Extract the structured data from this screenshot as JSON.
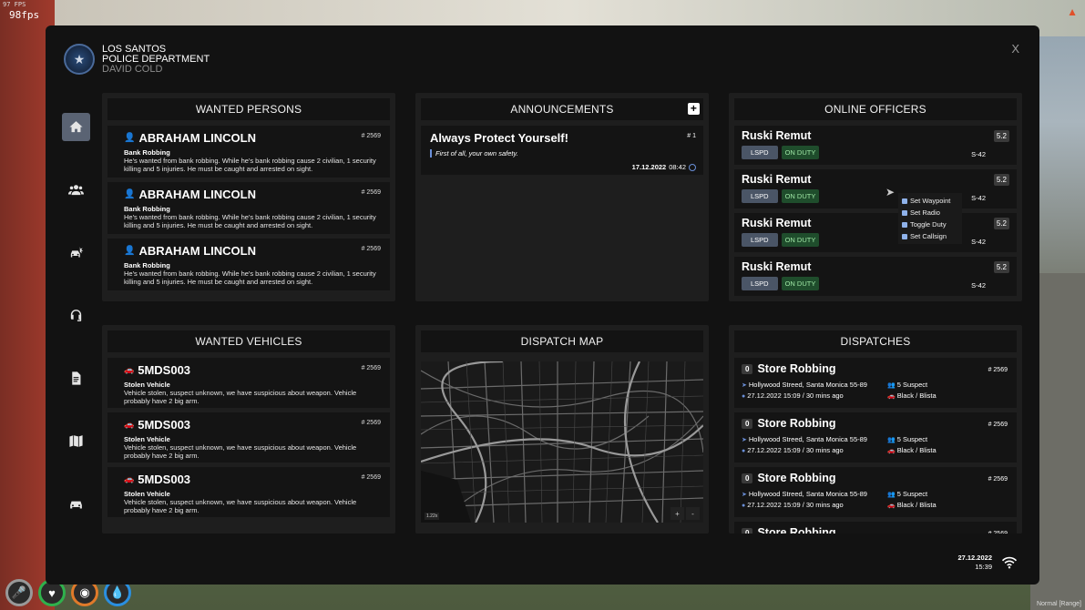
{
  "overlay": {
    "fps_small": "97 FPS",
    "fps": "98fps",
    "voice_text": "Normal [Range]"
  },
  "header": {
    "org_line1": "LOS SANTOS",
    "org_line2": "POLICE DEPARTMENT",
    "user_name": "DAVID COLD",
    "close_label": "X"
  },
  "sidebar": {
    "items": [
      {
        "icon": "home-icon",
        "active": true
      },
      {
        "icon": "users-icon",
        "active": false
      },
      {
        "icon": "car-crash-icon",
        "active": false
      },
      {
        "icon": "headset-icon",
        "active": false
      },
      {
        "icon": "document-icon",
        "active": false
      },
      {
        "icon": "map-icon",
        "active": false
      },
      {
        "icon": "car-icon",
        "active": false
      }
    ]
  },
  "wanted_persons": {
    "title": "WANTED PERSONS",
    "items": [
      {
        "name": "ABRAHAM LINCOLN",
        "num": "# 2569",
        "label": "Bank Robbing",
        "desc": "He's wanted from bank robbing. While he's bank robbing cause 2 civilian, 1 security killing and 5 injuries. He must be caught and arrested on sight."
      },
      {
        "name": "ABRAHAM LINCOLN",
        "num": "# 2569",
        "label": "Bank Robbing",
        "desc": "He's wanted from bank robbing. While he's bank robbing cause 2 civilian, 1 security killing and 5 injuries. He must be caught and arrested on sight."
      },
      {
        "name": "ABRAHAM LINCOLN",
        "num": "# 2569",
        "label": "Bank Robbing",
        "desc": "He's wanted from bank robbing. While he's bank robbing cause 2 civilian, 1 security killing and 5 injuries. He must be caught and arrested on sight."
      }
    ]
  },
  "announcements": {
    "title": "ANNOUNCEMENTS",
    "items": [
      {
        "title": "Always Protect Yourself!",
        "num": "# 1",
        "sub": "First of all, your own safety.",
        "date": "17.12.2022",
        "time": "08:42"
      }
    ]
  },
  "online_officers": {
    "title": "ONLINE OFFICERS",
    "items": [
      {
        "name": "Ruski Remut",
        "rank": "5.2",
        "dept": "LSPD",
        "status": "ON DUTY",
        "callsign": "S-42"
      },
      {
        "name": "Ruski Remut",
        "rank": "5.2",
        "dept": "LSPD",
        "status": "ON DUTY",
        "callsign": "S-42"
      },
      {
        "name": "Ruski Remut",
        "rank": "5.2",
        "dept": "LSPD",
        "status": "ON DUTY",
        "callsign": "S-42"
      },
      {
        "name": "Ruski Remut",
        "rank": "5.2",
        "dept": "LSPD",
        "status": "ON DUTY",
        "callsign": "S-42"
      }
    ],
    "context_menu": [
      "Set Waypoint",
      "Set Radio",
      "Toggle Duty",
      "Set Callsign"
    ]
  },
  "wanted_vehicles": {
    "title": "WANTED VEHICLES",
    "items": [
      {
        "plate": "5MDS003",
        "num": "# 2569",
        "label": "Stolen Vehicle",
        "desc": "Vehicle stolen, suspect unknown, we have suspicious about weapon. Vehicle probably have 2 big arm."
      },
      {
        "plate": "5MDS003",
        "num": "# 2569",
        "label": "Stolen Vehicle",
        "desc": "Vehicle stolen, suspect unknown, we have suspicious about weapon. Vehicle probably have 2 big arm."
      },
      {
        "plate": "5MDS003",
        "num": "# 2569",
        "label": "Stolen Vehicle",
        "desc": "Vehicle stolen, suspect unknown, we have suspicious about weapon. Vehicle probably have 2 big arm."
      }
    ]
  },
  "dispatch_map": {
    "title": "DISPATCH MAP",
    "zoom": "1.22x",
    "zoom_in": "+",
    "zoom_out": "-"
  },
  "dispatches": {
    "title": "DISPATCHES",
    "items": [
      {
        "badge": "0",
        "name": "Store Robbing",
        "num": "# 2569",
        "location": "Hollywood Streed, Santa Monica 55-89",
        "when": "27.12.2022 15:09 / 30 mins ago",
        "suspects": "5 Suspect",
        "vehicle": "Black / Blista"
      },
      {
        "badge": "0",
        "name": "Store Robbing",
        "num": "# 2569",
        "location": "Hollywood Streed, Santa Monica 55-89",
        "when": "27.12.2022 15:09 / 30 mins ago",
        "suspects": "5 Suspect",
        "vehicle": "Black / Blista"
      },
      {
        "badge": "0",
        "name": "Store Robbing",
        "num": "# 2569",
        "location": "Hollywood Streed, Santa Monica 55-89",
        "when": "27.12.2022 15:09 / 30 mins ago",
        "suspects": "5 Suspect",
        "vehicle": "Black / Blista"
      },
      {
        "badge": "0",
        "name": "Store Robbing",
        "num": "# 2569"
      }
    ]
  },
  "footer": {
    "date": "27.12.2022",
    "time": "15:39"
  },
  "colors": {
    "accent_blue": "#6a8fd8",
    "on_duty_green": "#1f4d2c",
    "lspd_tag": "#4a5566",
    "panel_bg": "#1e1e1e",
    "tablet_bg": "#121212"
  }
}
